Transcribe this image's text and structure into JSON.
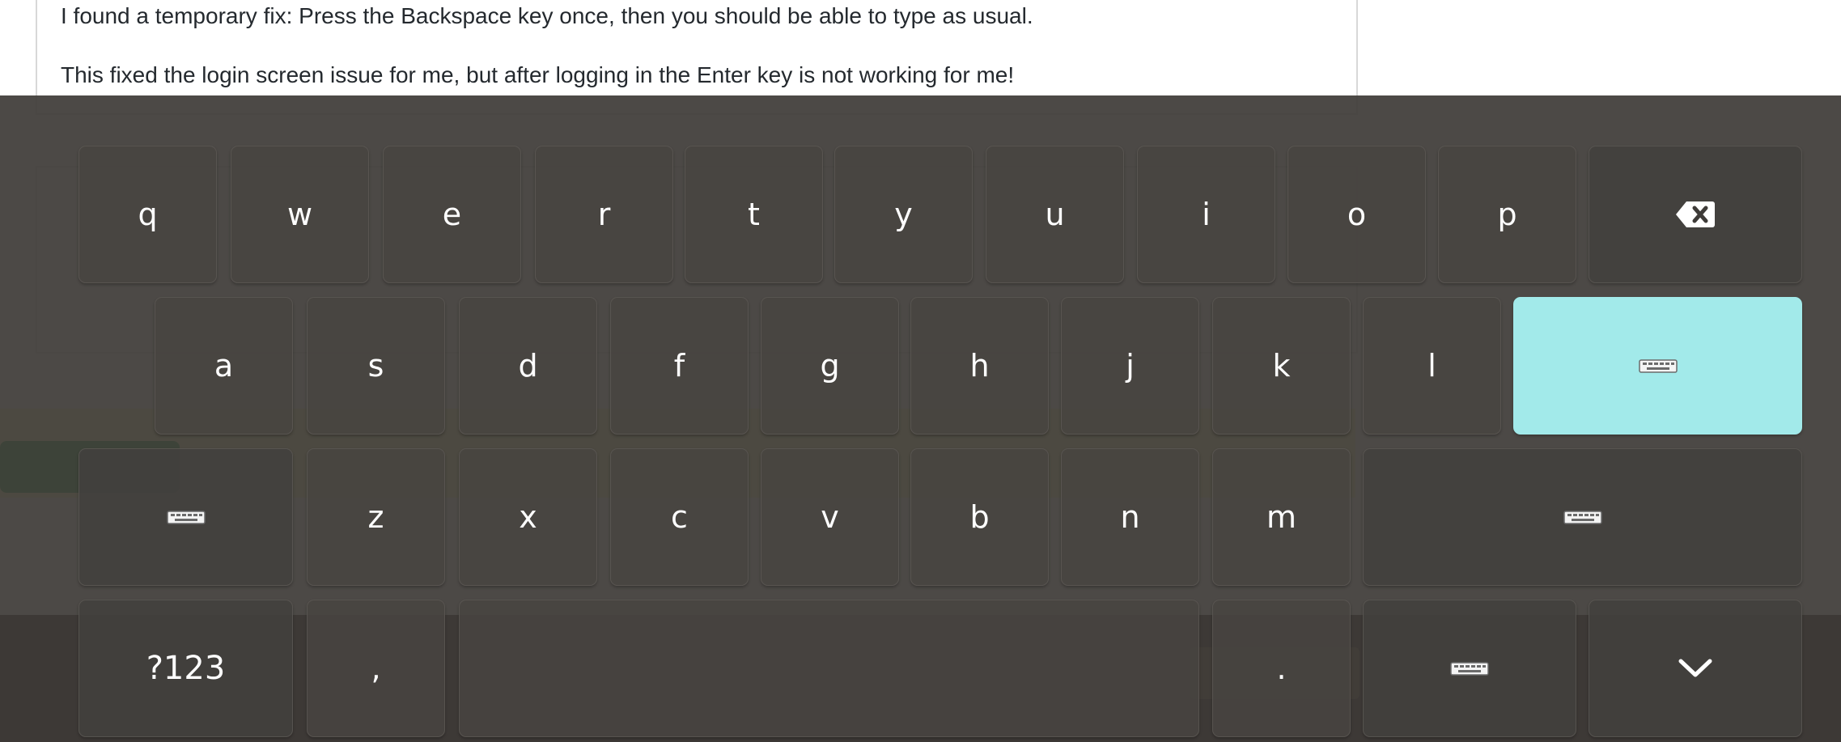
{
  "comment": {
    "line1": "I found a temporary fix: Press the Backspace key once, then you should be able to type as usual.",
    "line2": "This fixed the login screen issue for me, but after logging in the Enter key is not working for me!"
  },
  "keyboard": {
    "row1": [
      "q",
      "w",
      "e",
      "r",
      "t",
      "y",
      "u",
      "i",
      "o",
      "p"
    ],
    "row2": [
      "a",
      "s",
      "d",
      "f",
      "g",
      "h",
      "j",
      "k",
      "l"
    ],
    "row3": [
      "z",
      "x",
      "c",
      "v",
      "b",
      "n",
      "m"
    ],
    "row4": {
      "symbols_label": "?123",
      "comma_label": ",",
      "period_label": "."
    },
    "icons": {
      "backspace": "backspace-icon",
      "enter": "keyboard-icon",
      "shift_left": "keyboard-icon",
      "shift_right": "keyboard-icon",
      "layout": "keyboard-icon",
      "hide": "chevron-down-icon"
    },
    "colors": {
      "accent": "#a2eaea",
      "overlay": "#3e3b38"
    }
  }
}
